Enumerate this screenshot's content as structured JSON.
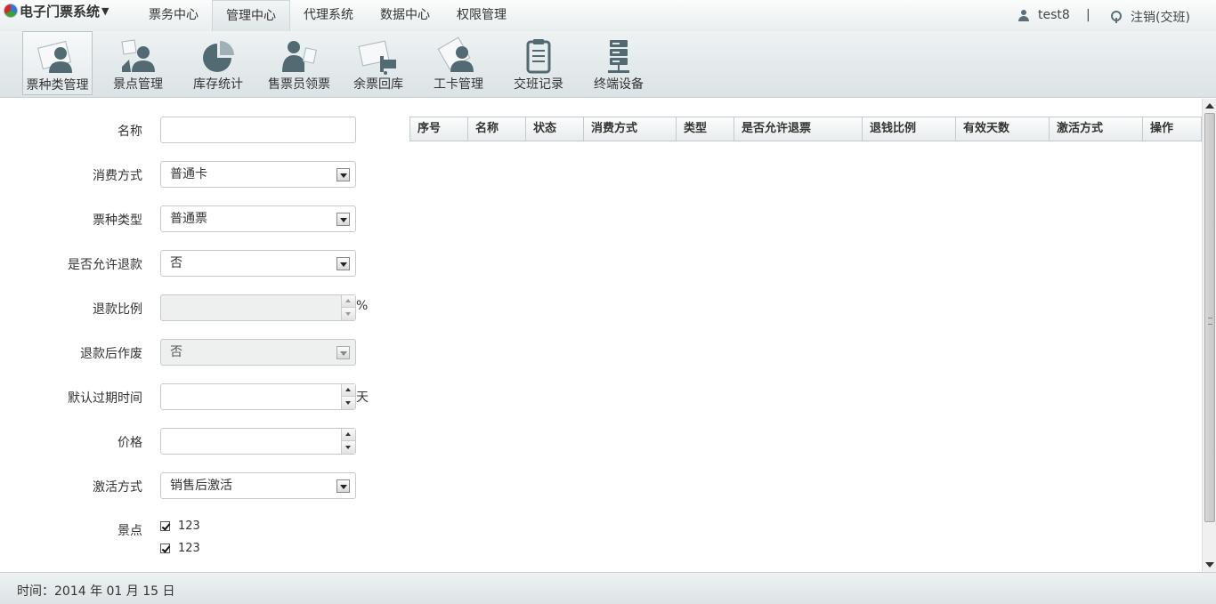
{
  "app": {
    "title": "电子门票系统"
  },
  "menu": {
    "items": [
      "票务中心",
      "管理中心",
      "代理系统",
      "数据中心",
      "权限管理"
    ],
    "active": "管理中心"
  },
  "user": {
    "name": "test8",
    "separator": "|",
    "logout": "注销(交班)"
  },
  "toolbar": {
    "items": [
      {
        "label": "票种类管理",
        "icon": "ticket-user-icon"
      },
      {
        "label": "景点管理",
        "icon": "scenic-user-icon"
      },
      {
        "label": "库存统计",
        "icon": "pie-chart-icon"
      },
      {
        "label": "售票员领票",
        "icon": "seller-icon"
      },
      {
        "label": "余票回库",
        "icon": "return-ticket-icon"
      },
      {
        "label": "工卡管理",
        "icon": "card-user-icon"
      },
      {
        "label": "交班记录",
        "icon": "clipboard-icon"
      },
      {
        "label": "终端设备",
        "icon": "server-icon"
      }
    ]
  },
  "form": {
    "name": {
      "label": "名称",
      "value": ""
    },
    "consume": {
      "label": "消费方式",
      "value": "普通卡"
    },
    "ticket_type": {
      "label": "票种类型",
      "value": "普通票"
    },
    "refund_allowed": {
      "label": "是否允许退款",
      "value": "否"
    },
    "refund_ratio": {
      "label": "退款比例",
      "value": "",
      "suffix": "%"
    },
    "void_after_refund": {
      "label": "退款后作废",
      "value": "否"
    },
    "default_expiry": {
      "label": "默认过期时间",
      "value": "",
      "suffix": "天"
    },
    "price": {
      "label": "价格",
      "value": ""
    },
    "activation": {
      "label": "激活方式",
      "value": "销售后激活"
    },
    "scenic": {
      "label": "景点",
      "options": [
        "123",
        "123"
      ]
    }
  },
  "table": {
    "columns": [
      "序号",
      "名称",
      "状态",
      "消费方式",
      "类型",
      "是否允许退票",
      "退钱比例",
      "有效天数",
      "激活方式",
      "操作"
    ]
  },
  "footer": {
    "text": "时间：2014 年 01 月 15 日"
  }
}
